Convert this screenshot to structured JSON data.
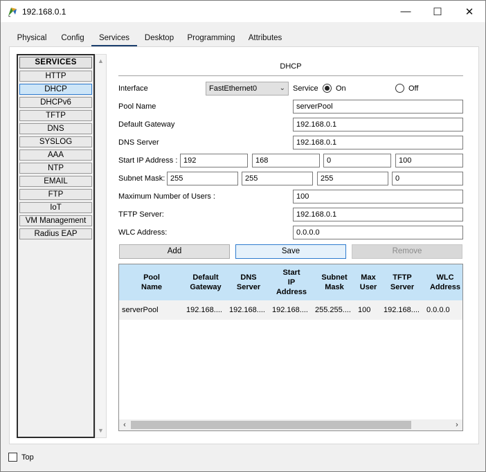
{
  "window": {
    "title": "192.168.0.1",
    "minimize": "—",
    "maximize": "☐",
    "close": "✕"
  },
  "tabs": [
    "Physical",
    "Config",
    "Services",
    "Desktop",
    "Programming",
    "Attributes"
  ],
  "active_tab": "Services",
  "services": {
    "header": "SERVICES",
    "items": [
      "HTTP",
      "DHCP",
      "DHCPv6",
      "TFTP",
      "DNS",
      "SYSLOG",
      "AAA",
      "NTP",
      "EMAIL",
      "FTP",
      "IoT",
      "VM Management",
      "Radius EAP"
    ],
    "selected": "DHCP"
  },
  "dhcp": {
    "title": "DHCP",
    "interface_label": "Interface",
    "interface_value": "FastEthernet0",
    "service_label": "Service",
    "on_label": "On",
    "off_label": "Off",
    "service_on": true,
    "pool_name_label": "Pool Name",
    "pool_name": "serverPool",
    "default_gateway_label": "Default Gateway",
    "default_gateway": "192.168.0.1",
    "dns_server_label": "DNS Server",
    "dns_server": "192.168.0.1",
    "start_ip_label": "Start IP Address :",
    "start_ip": [
      "192",
      "168",
      "0",
      "100"
    ],
    "subnet_mask_label": "Subnet Mask:",
    "subnet_mask": [
      "255",
      "255",
      "255",
      "0"
    ],
    "max_users_label": "Maximum Number of Users :",
    "max_users": "100",
    "tftp_label": "TFTP Server:",
    "tftp_server": "192.168.0.1",
    "wlc_label": "WLC Address:",
    "wlc_address": "0.0.0.0",
    "buttons": {
      "add": "Add",
      "save": "Save",
      "remove": "Remove"
    }
  },
  "table": {
    "columns": [
      "Pool\nName",
      "Default\nGateway",
      "DNS\nServer",
      "Start\nIP\nAddress",
      "Subnet\nMask",
      "Max\nUser",
      "TFTP\nServer",
      "WLC\nAddress"
    ],
    "rows": [
      [
        "serverPool",
        "192.168....",
        "192.168....",
        "192.168....",
        "255.255....",
        "100",
        "192.168....",
        "0.0.0.0"
      ]
    ],
    "scroll_left": "‹",
    "scroll_right": "›"
  },
  "footer": {
    "top_label": "Top",
    "top_checked": false
  }
}
